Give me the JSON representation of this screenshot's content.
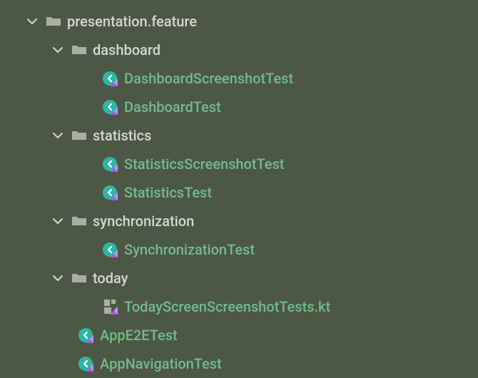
{
  "tree": {
    "root": {
      "label": "presentation.feature",
      "children": {
        "dashboard": {
          "label": "dashboard",
          "items": {
            "screenshot": "DashboardScreenshotTest",
            "test": "DashboardTest"
          }
        },
        "statistics": {
          "label": "statistics",
          "items": {
            "screenshot": "StatisticsScreenshotTest",
            "test": "StatisticsTest"
          }
        },
        "synchronization": {
          "label": "synchronization",
          "items": {
            "test": "SynchronizationTest"
          }
        },
        "today": {
          "label": "today",
          "items": {
            "file": "TodayScreenScreenshotTests.kt"
          }
        }
      },
      "files": {
        "e2e": "AppE2ETest",
        "nav": "AppNavigationTest"
      }
    }
  }
}
